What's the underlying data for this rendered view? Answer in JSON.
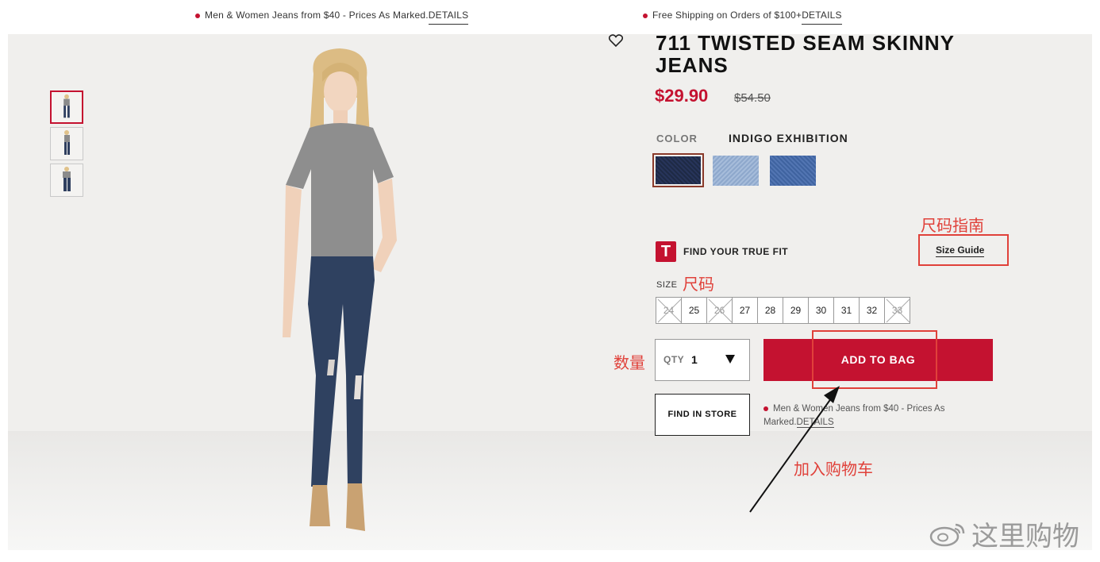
{
  "promo_bar": {
    "left_text": "Men & Women Jeans from $40 - Prices As Marked.",
    "left_link": "DETAILS",
    "right_text": "Free Shipping on Orders of $100+",
    "right_link": "DETAILS"
  },
  "product": {
    "title": "711 TWISTED SEAM SKINNY JEANS",
    "price": "$29.90",
    "old_price": "$54.50",
    "color_label": "COLOR",
    "color_name": "INDIGO EXHIBITION",
    "swatch_colors": [
      "#1e2a45",
      "#8ea8cc",
      "#3f63a0"
    ]
  },
  "fit": {
    "badge": "T",
    "label": "FIND YOUR TRUE FIT",
    "size_guide": "Size Guide"
  },
  "size": {
    "label": "SIZE",
    "options": [
      {
        "value": "24",
        "available": false
      },
      {
        "value": "25",
        "available": true
      },
      {
        "value": "26",
        "available": false
      },
      {
        "value": "27",
        "available": true
      },
      {
        "value": "28",
        "available": true
      },
      {
        "value": "29",
        "available": true
      },
      {
        "value": "30",
        "available": true
      },
      {
        "value": "31",
        "available": true
      },
      {
        "value": "32",
        "available": true
      },
      {
        "value": "33",
        "available": false
      }
    ]
  },
  "qty": {
    "label": "QTY",
    "value": "1"
  },
  "actions": {
    "add_to_bag": "ADD TO BAG",
    "find_in_store": "FIND IN STORE"
  },
  "promo_note": {
    "text": "Men & Women Jeans from $40 - Prices As Marked.",
    "link": "DETAILS"
  },
  "annotations": {
    "size_guide": "尺码指南",
    "size": "尺码",
    "qty": "数量",
    "add_to_cart": "加入购物车"
  },
  "watermark": "这里购物",
  "colors": {
    "accent": "#c41230",
    "annotation": "#e0413a"
  }
}
